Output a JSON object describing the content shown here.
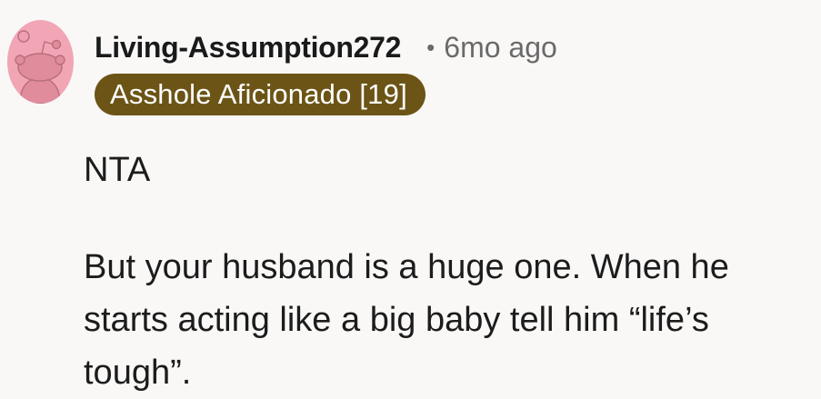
{
  "comment": {
    "author": "Living-Assumption272",
    "separator": "•",
    "timestamp": "6mo ago",
    "flair": "Asshole Aficionado [19]",
    "flair_color": "#6b5416",
    "avatar_icon": "reddit-snoo-avatar-icon",
    "body": [
      "NTA",
      "But your husband is a huge one. When he starts acting like a big baby tell him “life’s tough”."
    ]
  }
}
